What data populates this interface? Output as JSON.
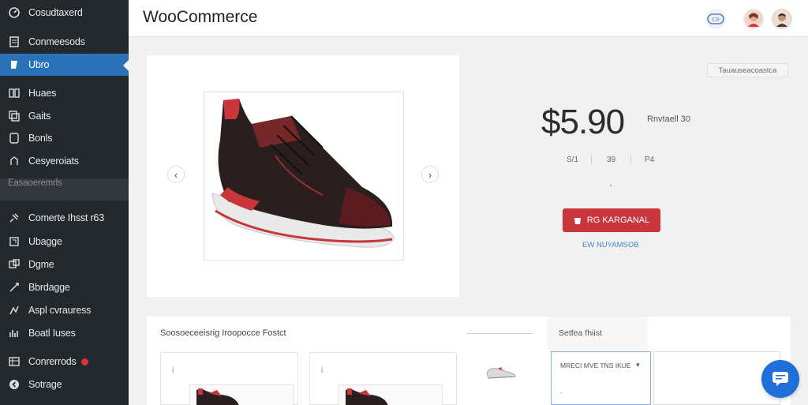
{
  "sidebar": {
    "items": [
      {
        "label": "Cosudtaxerd",
        "icon": "dashboard-icon"
      },
      {
        "label": "Conmeesods",
        "icon": "posts-icon"
      },
      {
        "label": "Ubro",
        "icon": "woocommerce-icon",
        "active": true
      },
      {
        "label": "Huaes",
        "icon": "pages-icon"
      },
      {
        "label": "Gaits",
        "icon": "media-icon"
      },
      {
        "label": "Bonls",
        "icon": "comments-icon"
      },
      {
        "label": "Cesyeroiats",
        "icon": "appearance-icon"
      },
      {
        "label": "Easaoeremrls",
        "icon": "",
        "muted": true
      },
      {
        "label": "Comerte Ihsst r63",
        "icon": "plugins-icon"
      },
      {
        "label": "Ubagge",
        "icon": "users-icon"
      },
      {
        "label": "Dgme",
        "icon": "tools-icon"
      },
      {
        "label": "Bbrdagge",
        "icon": "settings-icon"
      },
      {
        "label": "Aspl cvrauress",
        "icon": "analytics-icon"
      },
      {
        "label": "Boatl Iuses",
        "icon": "marketing-icon"
      },
      {
        "label": "Conrerrods",
        "icon": "orders-icon",
        "badge": true
      },
      {
        "label": "Sotrage",
        "icon": "collapse-icon"
      }
    ]
  },
  "header": {
    "title": "WooCommerce",
    "icons": [
      "woo-logo-icon",
      "avatar-woman-icon",
      "avatar-man-icon"
    ]
  },
  "product": {
    "price": "$5.90",
    "price_note": "Rnvtaell 30",
    "status": "Tauauseacoastca",
    "stats": [
      "S/1",
      "39",
      "P4"
    ],
    "cart_button": "RG KARGANAL",
    "sub_link": "EW NUYAMSOB"
  },
  "bottom": {
    "heading": "Soosoeceeisrig Iroopocce Fostct",
    "tab_label": "Setfea fhiist",
    "card_mark": "i",
    "select_value": "MRECI MVE TNS IKUE",
    "select_sub": "·"
  },
  "colors": {
    "sidebar_bg": "#23282d",
    "active_blue": "#2a72b8",
    "cart_red": "#c8363c",
    "chat_blue": "#1e6fd9"
  }
}
